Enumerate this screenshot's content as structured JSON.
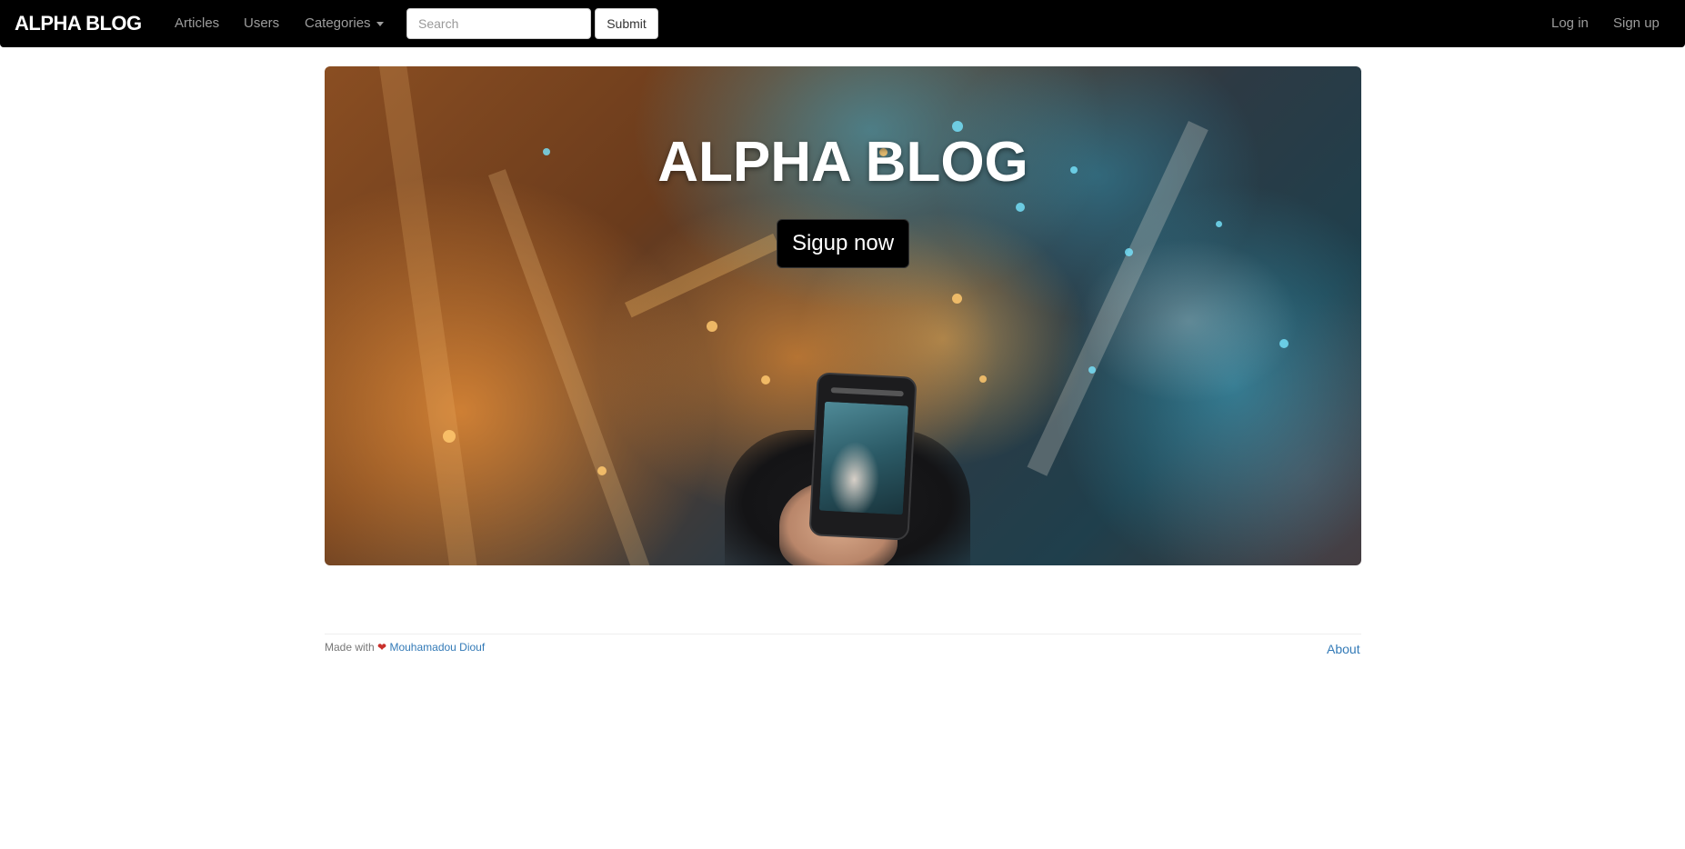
{
  "navbar": {
    "brand": "ALPHA BLOG",
    "links": {
      "articles": "Articles",
      "users": "Users",
      "categories": "Categories"
    },
    "search": {
      "placeholder": "Search",
      "value": ""
    },
    "submit_label": "Submit",
    "login_label": "Log in",
    "signup_label": "Sign up"
  },
  "hero": {
    "title": "ALPHA BLOG",
    "button_label": "Sigup now"
  },
  "footer": {
    "made_with": "Made with",
    "heart_icon": "heart-icon",
    "author": "Mouhamadou Diouf",
    "about_label": "About"
  },
  "colors": {
    "navbar_bg": "#000000",
    "nav_text": "#9d9d9d",
    "link": "#337ab7",
    "heart": "#c9302c"
  }
}
